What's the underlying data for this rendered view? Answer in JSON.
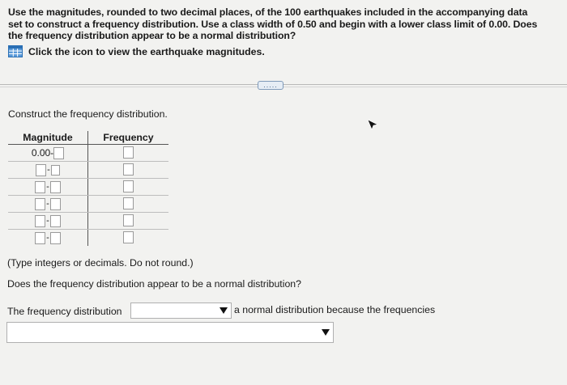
{
  "question": {
    "text": "Use the magnitudes, rounded to two decimal places, of the 100 earthquakes included in the accompanying data set to construct a frequency distribution. Use a class width of 0.50 and begin with a lower class limit of 0.00. Does the frequency distribution appear to be a normal distribution?"
  },
  "data_link": {
    "icon": "table-icon",
    "label": "Click the icon to view the earthquake magnitudes."
  },
  "more_button": {
    "label": "....."
  },
  "section": {
    "label": "Construct the frequency distribution."
  },
  "table": {
    "headers": {
      "magnitude": "Magnitude",
      "frequency": "Frequency"
    },
    "first_lower": "0.00-",
    "row_count": 6
  },
  "note": "(Type integers or decimals. Do not round.)",
  "question2": "Does the frequency distribution appear to be a normal distribution?",
  "answer": {
    "prefix": "The frequency distribution",
    "suffix": "a normal distribution because the frequencies"
  },
  "colors": {
    "accent": "#2a6fb4",
    "background": "#f2f2f0"
  }
}
